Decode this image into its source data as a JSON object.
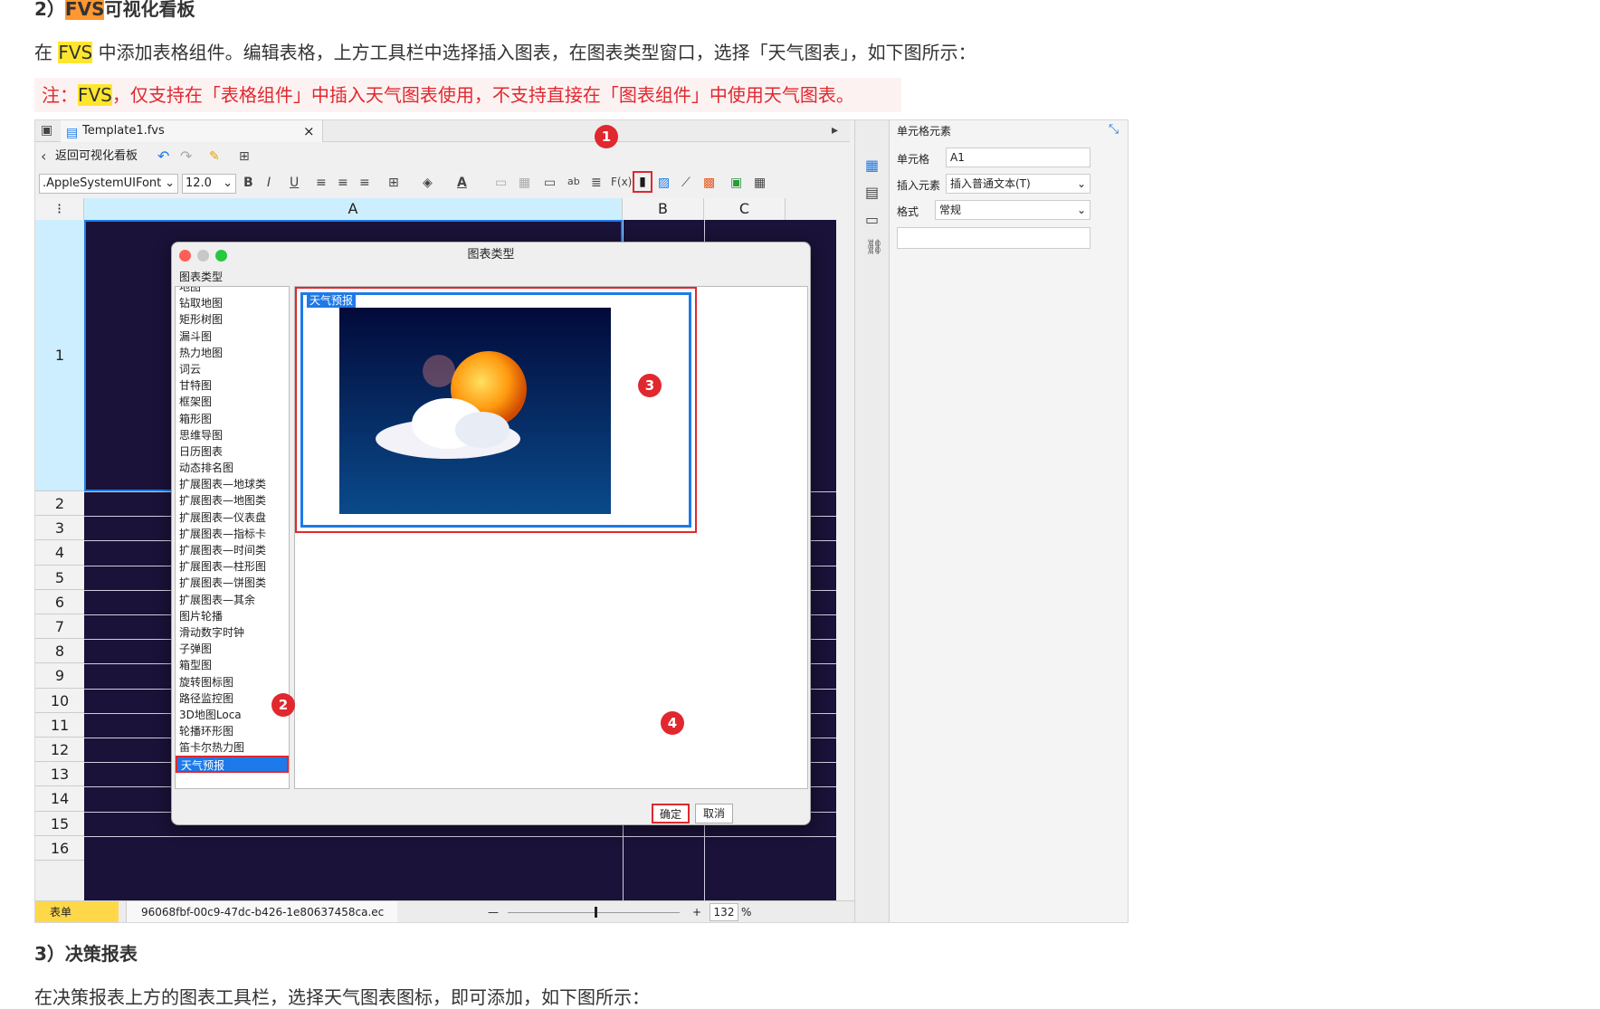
{
  "heading": {
    "prefix": "2）",
    "fvs": "FVS",
    "suffix": "可视化看板"
  },
  "intro": {
    "before": "在 ",
    "fvs": "FVS",
    "after": " 中添加表格组件。编辑表格，上方工具栏中选择插入图表，在图表类型窗口，选择「天气图表」，如下图所示："
  },
  "note": {
    "before": "注：",
    "fvs": "FVS",
    "after": "，仅支持在「表格组件」中插入天气图表使用，不支持直接在「图表组件」中使用天气图表。"
  },
  "app": {
    "tab_title": "Template1.fvs",
    "back_label": "返回可视化看板",
    "font": ".AppleSystemUIFont",
    "font_size": "12.0",
    "columns": [
      "A",
      "B",
      "C"
    ],
    "rows": [
      "1",
      "2",
      "3",
      "4",
      "5",
      "6",
      "7",
      "8",
      "9",
      "10",
      "11",
      "12",
      "13",
      "14",
      "15",
      "16"
    ],
    "dialog_title": "图表类型",
    "list_header": "图表类型",
    "list_items": [
      "地图",
      "钻取地图",
      "矩形树图",
      "漏斗图",
      "热力地图",
      "词云",
      "甘特图",
      "框架图",
      "箱形图",
      "思维导图",
      "日历图表",
      "动态排名图",
      "扩展图表—地球类",
      "扩展图表—地图类",
      "扩展图表—仪表盘",
      "扩展图表—指标卡",
      "扩展图表—时间类",
      "扩展图表—柱形图",
      "扩展图表—饼图类",
      "扩展图表—其余",
      "图片轮播",
      "滑动数字时钟",
      "子弹图",
      "箱型图",
      "旋转图标图",
      "路径监控图",
      "3D地图Loca",
      "轮播环形图",
      "笛卡尔热力图",
      "天气预报"
    ],
    "preview_label": "天气预报",
    "ok": "确定",
    "cancel": "取消",
    "badges": [
      "1",
      "2",
      "3",
      "4"
    ],
    "right_panel": {
      "title": "单元格元素",
      "cell_label": "单元格",
      "cell_value": "A1",
      "insert_label": "插入元素",
      "insert_value": "插入普通文本(T)",
      "format_label": "格式",
      "format_value": "常规"
    },
    "status": {
      "sheet": "表单",
      "file": "96068fbf-00c9-47dc-b426-1e80637458ca.ec",
      "zoom": "132",
      "pct": "%",
      "minus": "—",
      "plus": "+"
    }
  },
  "heading3": "3）决策报表",
  "para3": "在决策报表上方的图表工具栏，选择天气图表图标，即可添加，如下图所示："
}
